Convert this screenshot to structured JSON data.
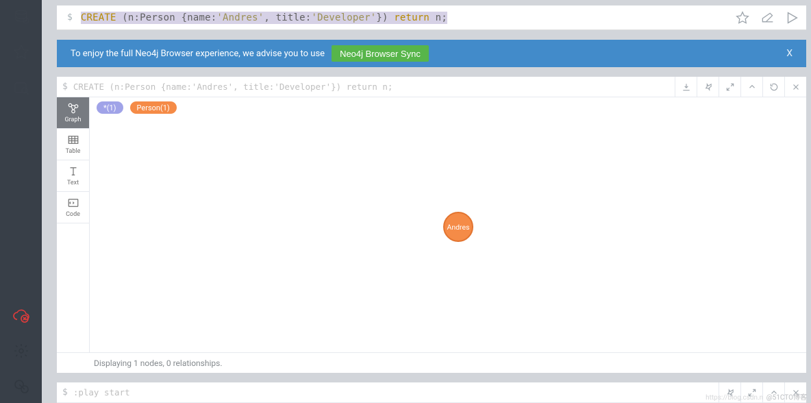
{
  "sidebar": {
    "top_icons": [
      "database-icon",
      "star-icon",
      "folder-search-icon"
    ],
    "bottom_icons": [
      "cloud-error-icon",
      "settings-icon",
      "about-icon"
    ]
  },
  "editor": {
    "prompt": "$",
    "query": {
      "keyword1": "CREATE",
      "paren_open": "(",
      "var": "n",
      "label": ":Person ",
      "brace_open": "{",
      "prop1": "name:",
      "str1": "'Andres'",
      "comma": ", ",
      "prop2": "title:",
      "str2": "'Developer'",
      "brace_close": "}",
      "paren_close": ")",
      "keyword2": " return ",
      "var2": "n",
      "semi": ";"
    }
  },
  "banner": {
    "text": "To enjoy the full Neo4j Browser experience, we advise you to use",
    "button": "Neo4j Browser Sync",
    "close": "X"
  },
  "result": {
    "prompt": "$",
    "query_text": "CREATE (n:Person {name:'Andres', title:'Developer'}) return n;",
    "tabs": {
      "graph": "Graph",
      "table": "Table",
      "text": "Text",
      "code": "Code"
    },
    "tags": {
      "star": "*(1)",
      "person": "Person(1)"
    },
    "node_label": "Andres",
    "footer": "Displaying 1 nodes, 0 relationships."
  },
  "play": {
    "prompt": "$",
    "command": ":play start"
  },
  "watermark": {
    "left": "https://blog.csdn.n",
    "right": "@51CTO博客"
  }
}
